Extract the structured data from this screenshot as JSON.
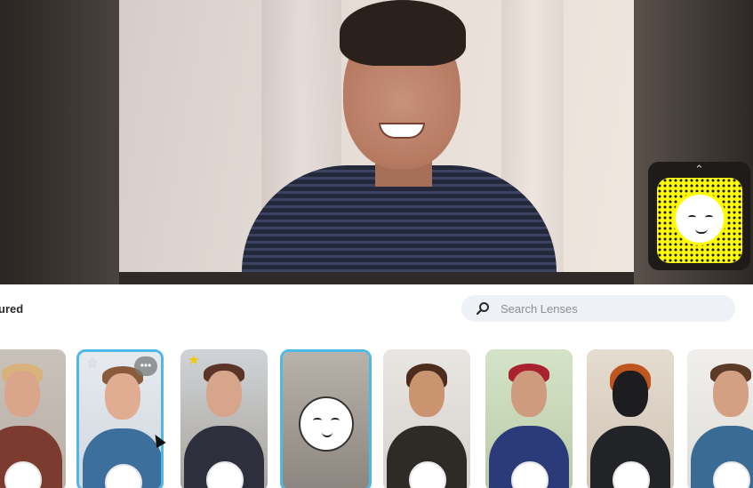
{
  "preview": {
    "snapcode_chevron": "⌃",
    "snapcode_color": "#fffc00"
  },
  "lens_tray": {
    "section_title": "ured",
    "search": {
      "placeholder": "Search Lenses",
      "value": ""
    },
    "accent": "#4fb8e6"
  },
  "lenses": [
    {
      "name": "puppy-lens",
      "favorite": false,
      "selected": false
    },
    {
      "name": "big-mouth-lens",
      "favorite": false,
      "selected": true,
      "more_label": "•••"
    },
    {
      "name": "flower-crown-lens",
      "favorite": true,
      "selected": false
    },
    {
      "name": "emoji-face-lens",
      "favorite": false,
      "selected": true
    },
    {
      "name": "curly-hair-lens",
      "favorite": false,
      "selected": false
    },
    {
      "name": "devil-horns-lens",
      "favorite": false,
      "selected": false
    },
    {
      "name": "panda-ears-mask-lens",
      "favorite": false,
      "selected": false
    },
    {
      "name": "mustache-lens",
      "favorite": false,
      "selected": false
    }
  ]
}
